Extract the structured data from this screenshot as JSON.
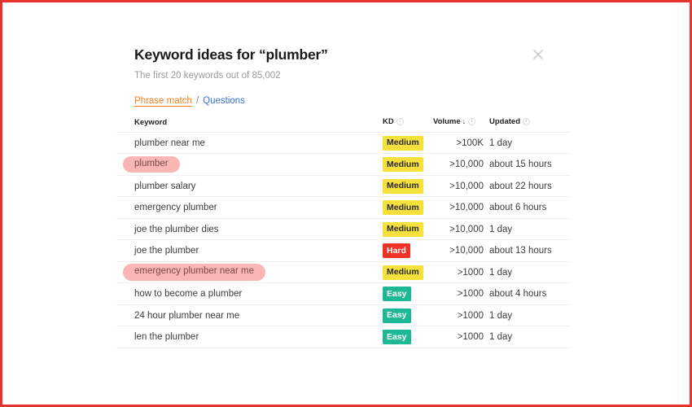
{
  "modal": {
    "title": "Keyword ideas for “plumber”",
    "subtitle": "The first 20 keywords out of 85,002",
    "close_icon": "close-icon"
  },
  "tabs": {
    "active_label": "Phrase match",
    "separator": "/",
    "secondary_label": "Questions"
  },
  "table": {
    "headers": {
      "keyword": "Keyword",
      "kd": "KD",
      "volume": "Volume",
      "volume_sort_arrow": "↓",
      "updated": "Updated",
      "info_glyph": "i"
    },
    "rows": [
      {
        "keyword": "plumber near me",
        "highlighted": false,
        "kd": "Medium",
        "kd_level": "medium",
        "volume": ">100K",
        "updated": "1 day"
      },
      {
        "keyword": "plumber",
        "highlighted": true,
        "kd": "Medium",
        "kd_level": "medium",
        "volume": ">10,000",
        "updated": "about 15 hours"
      },
      {
        "keyword": "plumber salary",
        "highlighted": false,
        "kd": "Medium",
        "kd_level": "medium",
        "volume": ">10,000",
        "updated": "about 22 hours"
      },
      {
        "keyword": "emergency plumber",
        "highlighted": false,
        "kd": "Medium",
        "kd_level": "medium",
        "volume": ">10,000",
        "updated": "about 6 hours"
      },
      {
        "keyword": "joe the plumber dies",
        "highlighted": false,
        "kd": "Medium",
        "kd_level": "medium",
        "volume": ">10,000",
        "updated": "1 day"
      },
      {
        "keyword": "joe the plumber",
        "highlighted": false,
        "kd": "Hard",
        "kd_level": "hard",
        "volume": ">10,000",
        "updated": "about 13 hours"
      },
      {
        "keyword": "emergency plumber near me",
        "highlighted": true,
        "kd": "Medium",
        "kd_level": "medium",
        "volume": ">1000",
        "updated": "1 day"
      },
      {
        "keyword": "how to become a plumber",
        "highlighted": false,
        "kd": "Easy",
        "kd_level": "easy",
        "volume": ">1000",
        "updated": "about 4 hours"
      },
      {
        "keyword": "24 hour plumber near me",
        "highlighted": false,
        "kd": "Easy",
        "kd_level": "easy",
        "volume": ">1000",
        "updated": "1 day"
      },
      {
        "keyword": "len the plumber",
        "highlighted": false,
        "kd": "Easy",
        "kd_level": "easy",
        "volume": ">1000",
        "updated": "1 day"
      }
    ]
  },
  "colors": {
    "screenshot_border": "#e8332f",
    "tab_active": "#f58220",
    "tab_link": "#3a6fd8",
    "badge_medium_bg": "#f5e03c",
    "badge_hard_bg": "#f03127",
    "badge_easy_bg": "#1fb894",
    "highlight_pill_bg": "#f9b6b4"
  }
}
